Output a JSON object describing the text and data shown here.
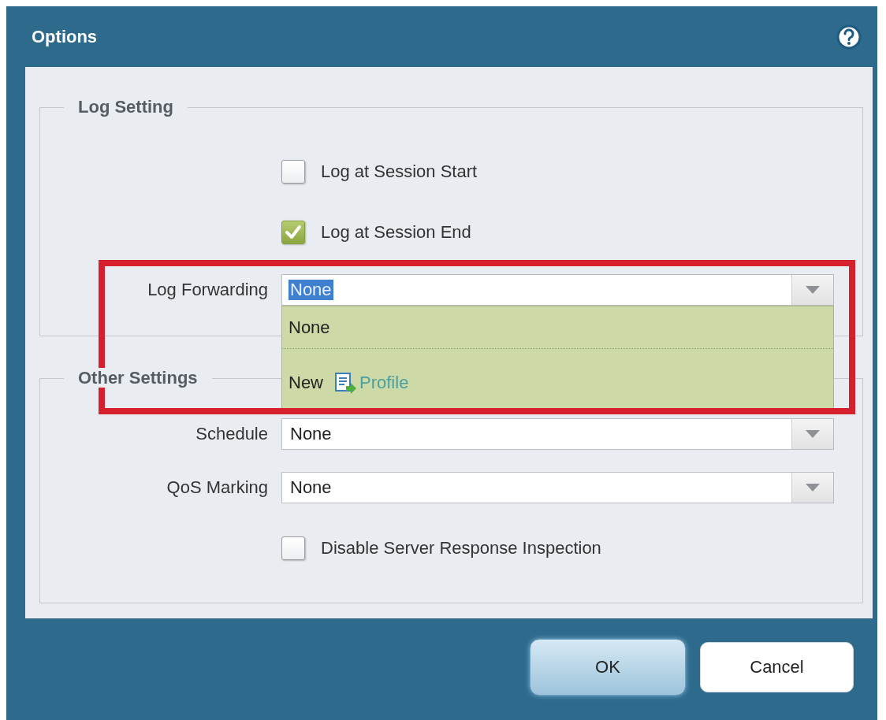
{
  "dialog": {
    "title": "Options"
  },
  "log_setting": {
    "legend": "Log Setting",
    "checkboxes": [
      {
        "label": "Log at Session Start",
        "checked": false
      },
      {
        "label": "Log at Session End",
        "checked": true
      }
    ],
    "log_forwarding": {
      "label": "Log Forwarding",
      "value": "None",
      "value_highlighted": true,
      "expanded": true,
      "options": [
        {
          "kind": "text",
          "label": "None"
        },
        {
          "kind": "action",
          "label": "New",
          "link": "Profile"
        }
      ]
    }
  },
  "other_settings": {
    "legend": "Other Settings",
    "fields": [
      {
        "label": "Schedule",
        "value": "None"
      },
      {
        "label": "QoS Marking",
        "value": "None"
      }
    ],
    "checkboxes": [
      {
        "label": "Disable Server Response Inspection",
        "checked": false
      }
    ]
  },
  "buttons": [
    {
      "label": "OK",
      "kind": "primary"
    },
    {
      "label": "Cancel",
      "kind": "secondary"
    }
  ]
}
